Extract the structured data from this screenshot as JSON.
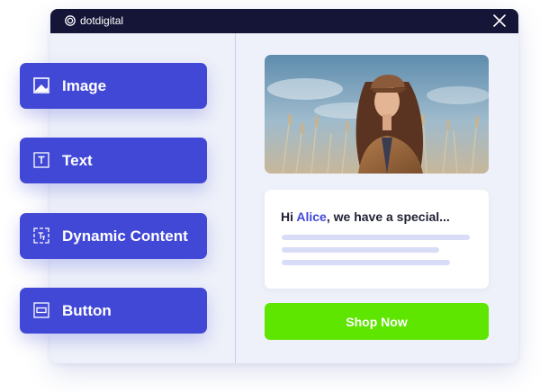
{
  "window": {
    "brand": "dotdigital"
  },
  "blocks": [
    {
      "label": "Image",
      "icon": "image-icon"
    },
    {
      "label": "Text",
      "icon": "text-icon"
    },
    {
      "label": "Dynamic Content",
      "icon": "dynamic-content-icon"
    },
    {
      "label": "Button",
      "icon": "button-icon"
    }
  ],
  "preview": {
    "hero_image": "photo-of-woman-in-cap-and-trench-coat",
    "greeting_prefix": "Hi ",
    "greeting_name": "Alice",
    "greeting_suffix": ", we have a special...",
    "cta_label": "Shop Now"
  },
  "colors": {
    "titlebar": "#151537",
    "block_button": "#4148d6",
    "accent_name": "#4248d8",
    "cta": "#5ee500",
    "placeholder_line": "#d9dcf6"
  }
}
